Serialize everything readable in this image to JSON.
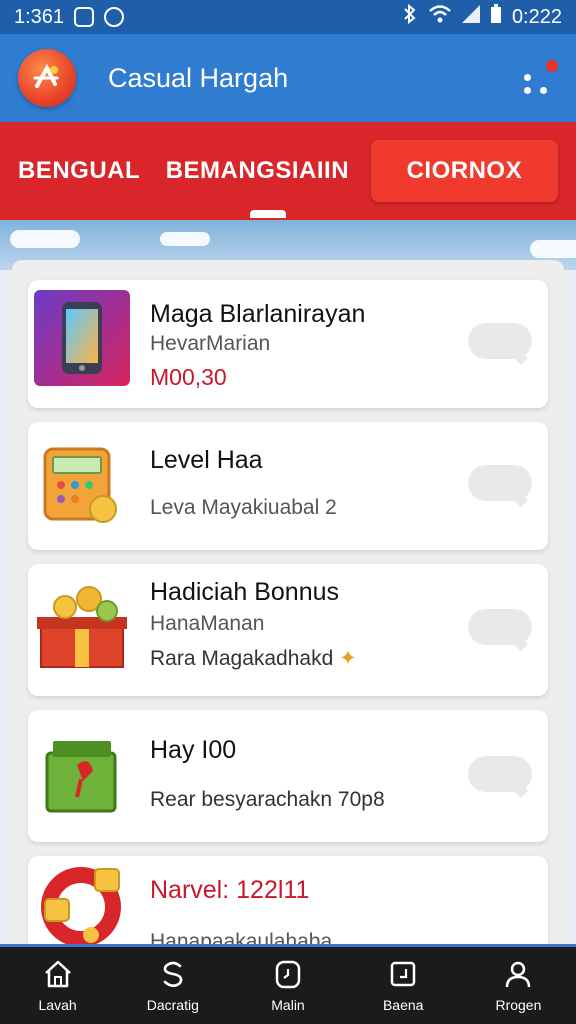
{
  "status_bar": {
    "time_left": "1:361",
    "time_right": "0:222"
  },
  "app_bar": {
    "title": "Casual Hargah"
  },
  "tabs": [
    {
      "label": "BENGUAL"
    },
    {
      "label": "BEMANGSIAIIN"
    },
    {
      "label": "CIORNOX"
    }
  ],
  "cards": [
    {
      "title": "Maga Blarlanirayan",
      "subtitle": "HevarMarian",
      "price": "M00,30",
      "icon": "phone-icon"
    },
    {
      "title": "Level Haa",
      "subtitle": "Leva Mayakiuabal 2",
      "icon": "calculator-icon"
    },
    {
      "title": "Hadiciah Bonnus",
      "subtitle": "HanaManan",
      "detail": "Rara Magakadhakd",
      "icon": "treasure-box-icon"
    },
    {
      "title": "Hay I00",
      "subtitle": "Rear besyarachakn 70p8",
      "icon": "gift-box-icon"
    },
    {
      "title": "Narvel: 122l11",
      "subtitle": "Hanapaakaulahaba",
      "icon": "coin-ring-icon"
    }
  ],
  "bottom_nav": [
    {
      "label": "Lavah",
      "icon": "home-icon"
    },
    {
      "label": "Dacratig",
      "icon": "s-icon"
    },
    {
      "label": "Malin",
      "icon": "clock-icon"
    },
    {
      "label": "Baena",
      "icon": "bag-icon"
    },
    {
      "label": "Rrogen",
      "icon": "user-icon"
    }
  ],
  "colors": {
    "appbar": "#2f7cd0",
    "tabbar": "#d9262b",
    "active_tab": "#f03a2e",
    "price": "#c8182b"
  }
}
